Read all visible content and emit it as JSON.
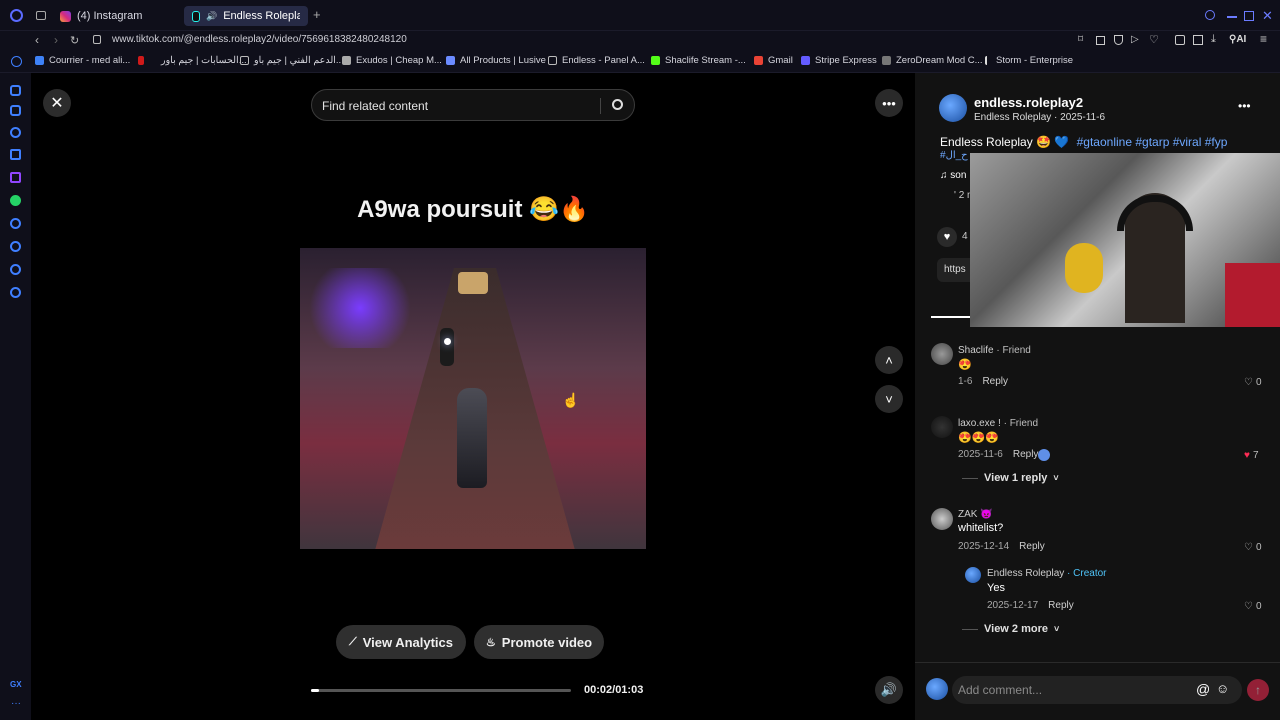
{
  "browser": {
    "tabs": [
      {
        "label": "(4) Instagram",
        "active": false
      },
      {
        "label": "Endless Roleplay (@en",
        "active": true
      }
    ],
    "new_tab": "+",
    "url": "www.tiktok.com/@endless.roleplay2/video/7569618382480248120",
    "ai_label": "AI",
    "bookmarks": [
      "Courrier - med ali...",
      "الحسابات | جيم باور...",
      "الدعم الفني | جيم باو...",
      "Exudos | Cheap M...",
      "All Products | Lusive",
      "Endless - Panel A...",
      "Shaclife Stream -...",
      "Gmail",
      "Stripe Express",
      "ZeroDream Mod C...",
      "Storm - Enterprise"
    ]
  },
  "video": {
    "search_placeholder": "Find related content",
    "caption": "A9wa poursuit 😂🔥",
    "view_analytics": "View Analytics",
    "promote_video": "Promote video",
    "time": "00:02/01:03",
    "progress": 0.032
  },
  "post": {
    "username": "endless.roleplay2",
    "subline": "Endless Roleplay · 2025-11-6",
    "description": "Endless Roleplay 🤩 💙",
    "hashtags": "#gtaonline #gtarp #viral #fyp",
    "hashtag2": "#ح_ال",
    "sound": "son",
    "extra": "' 2 n",
    "likes": "4",
    "link": "https"
  },
  "comments": [
    {
      "name": "Shaclife",
      "tag": "· Friend",
      "text": "😍",
      "date": "1-6",
      "reply": "Reply",
      "likes": "0",
      "liked": false
    },
    {
      "name": "laxo.exe !",
      "tag": "· Friend",
      "text": "😍😍😍",
      "date": "2025-11-6",
      "reply": "Reply",
      "likes": "7",
      "liked": true,
      "view_replies": "View 1 reply"
    },
    {
      "name": "ZAK 👿",
      "tag": "",
      "text": "whitelist?",
      "date": "2025-12-14",
      "reply": "Reply",
      "likes": "0",
      "liked": false
    }
  ],
  "creator_reply": {
    "name": "Endless Roleplay",
    "tag": "· Creator",
    "text": "Yes",
    "date": "2025-12-17",
    "reply": "Reply",
    "likes": "0",
    "view_more": "View 2 more"
  },
  "comment_input": {
    "placeholder": "Add comment..."
  },
  "colors": {
    "accent": "#fe2c55",
    "hashtag": "#6ea8ff",
    "creator": "#4fc3f7"
  }
}
